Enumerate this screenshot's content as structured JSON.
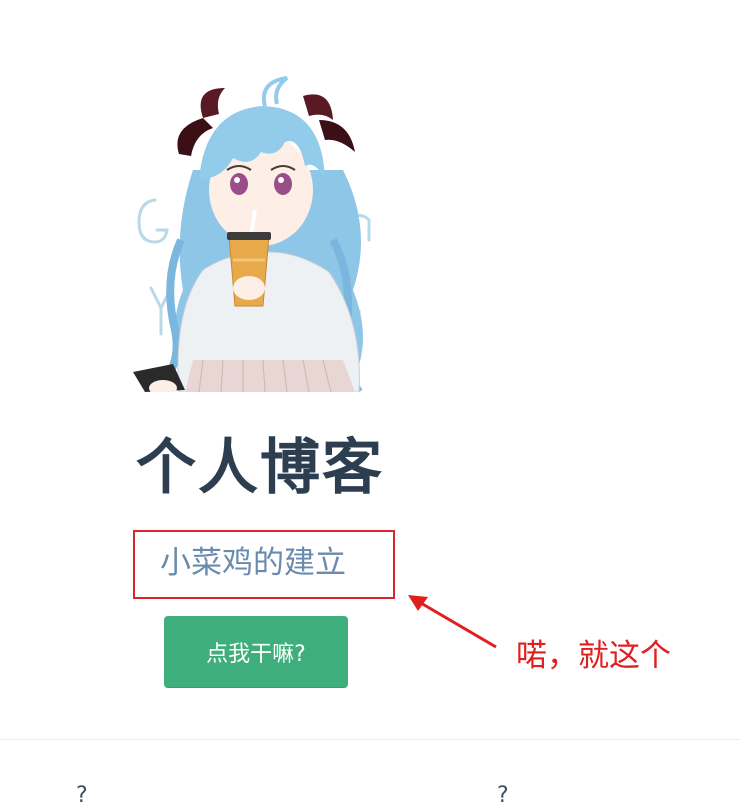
{
  "hero": {
    "title": "个人博客",
    "description": "小菜鸡的建立",
    "action_label": "点我干嘛?",
    "image_alt": "Ganyu anime girl drinking bubble tea"
  },
  "annotation": {
    "text": "喏，就这个",
    "color": "#e0201f"
  },
  "features": [
    {
      "title": "?"
    },
    {
      "title": "?"
    }
  ],
  "colors": {
    "accent": "#3eaf7c",
    "title": "#2c3e50",
    "description": "#6a8bad",
    "highlight_box": "#d8262c"
  }
}
